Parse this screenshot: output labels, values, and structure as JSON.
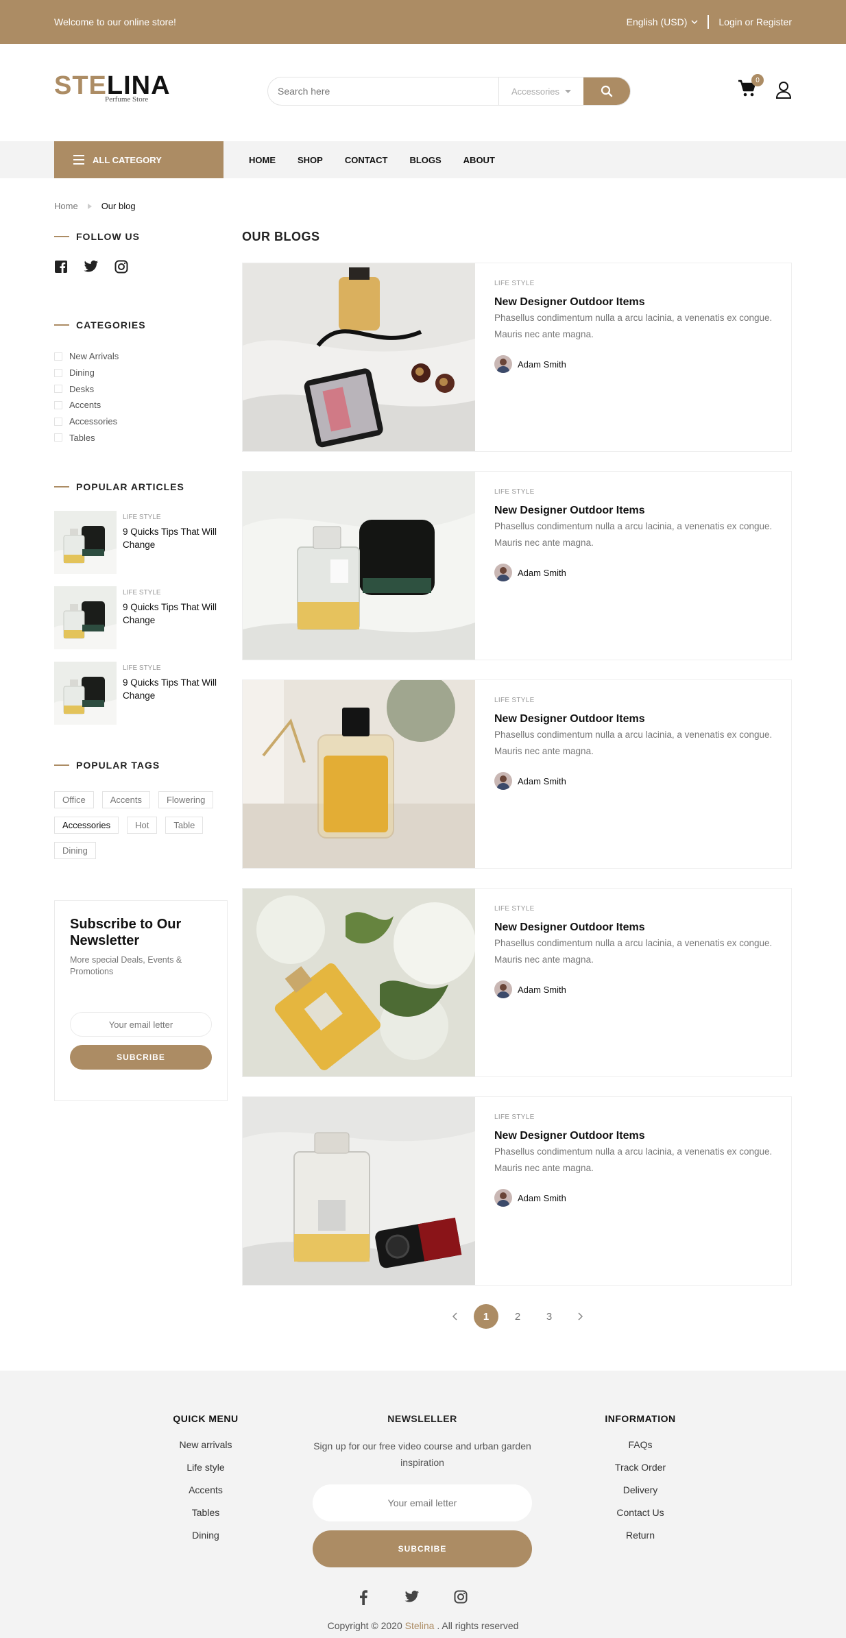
{
  "topbar": {
    "welcome": "Welcome to our online store!",
    "language": "English (USD)",
    "login": "Login or Register"
  },
  "brand": {
    "part1": "STE",
    "part2": "LINA",
    "tagline": "Perfume Store"
  },
  "search": {
    "placeholder": "Search here",
    "category": "Accessories"
  },
  "cart": {
    "count": "0"
  },
  "nav": {
    "all_category": "ALL CATEGORY",
    "items": [
      "HOME",
      "SHOP",
      "CONTACT",
      "BLOGS",
      "ABOUT"
    ]
  },
  "breadcrumb": {
    "home": "Home",
    "current": "Our blog"
  },
  "sidebar": {
    "follow_title": "FOLLOW US",
    "categories_title": "CATEGORIES",
    "categories": [
      "New Arrivals",
      "Dining",
      "Desks",
      "Accents",
      "Accessories",
      "Tables"
    ],
    "popular_title": "POPULAR ARTICLES",
    "popular": [
      {
        "label": "LIFE STYLE",
        "title": "9 Quicks Tips That Will Change"
      },
      {
        "label": "LIFE STYLE",
        "title": "9 Quicks Tips That Will Change"
      },
      {
        "label": "LIFE STYLE",
        "title": "9 Quicks Tips That Will Change"
      }
    ],
    "tags_title": "POPULAR TAGS",
    "tags": [
      "Office",
      "Accents",
      "Flowering",
      "Accessories",
      "Hot",
      "Table",
      "Dining"
    ],
    "newsletter": {
      "title": "Subscribe to Our Newsletter",
      "text": "More special Deals, Events & Promotions",
      "placeholder": "Your email letter",
      "button": "SUBCRIBE"
    }
  },
  "blogs": {
    "title": "OUR BLOGS",
    "posts": [
      {
        "label": "LIFE STYLE",
        "title": "New Designer Outdoor Items",
        "excerpt": "Phasellus condimentum nulla a arcu lacinia, a venenatis ex congue. Mauris nec ante magna.",
        "author": "Adam Smith"
      },
      {
        "label": "LIFE STYLE",
        "title": "New Designer Outdoor Items",
        "excerpt": "Phasellus condimentum nulla a arcu lacinia, a venenatis ex congue. Mauris nec ante magna.",
        "author": "Adam Smith"
      },
      {
        "label": "LIFE STYLE",
        "title": "New Designer Outdoor Items",
        "excerpt": "Phasellus condimentum nulla a arcu lacinia, a venenatis ex congue. Mauris nec ante magna.",
        "author": "Adam Smith"
      },
      {
        "label": "LIFE STYLE",
        "title": "New Designer Outdoor Items",
        "excerpt": "Phasellus condimentum nulla a arcu lacinia, a venenatis ex congue. Mauris nec ante magna.",
        "author": "Adam Smith"
      },
      {
        "label": "LIFE STYLE",
        "title": "New Designer Outdoor Items",
        "excerpt": "Phasellus condimentum nulla a arcu lacinia, a venenatis ex congue. Mauris nec ante magna.",
        "author": "Adam Smith"
      }
    ]
  },
  "pagination": {
    "pages": [
      "1",
      "2",
      "3"
    ],
    "current": "1"
  },
  "footer": {
    "quick_title": "QUICK MENU",
    "quick": [
      "New arrivals",
      "Life style",
      "Accents",
      "Tables",
      "Dining"
    ],
    "news_title": "NEWSLELLER",
    "news_text": "Sign up for our free video course and urban garden inspiration",
    "news_placeholder": "Your email letter",
    "news_button": "SUBCRIBE",
    "info_title": "INFORMATION",
    "info": [
      "FAQs",
      "Track Order",
      "Delivery",
      "Contact Us",
      "Return"
    ],
    "copy_pre": "Copyright © 2020 ",
    "copy_brand": "Stelina",
    "copy_post": " . All rights reserved"
  },
  "colors": {
    "accent": "#ac8c64"
  }
}
